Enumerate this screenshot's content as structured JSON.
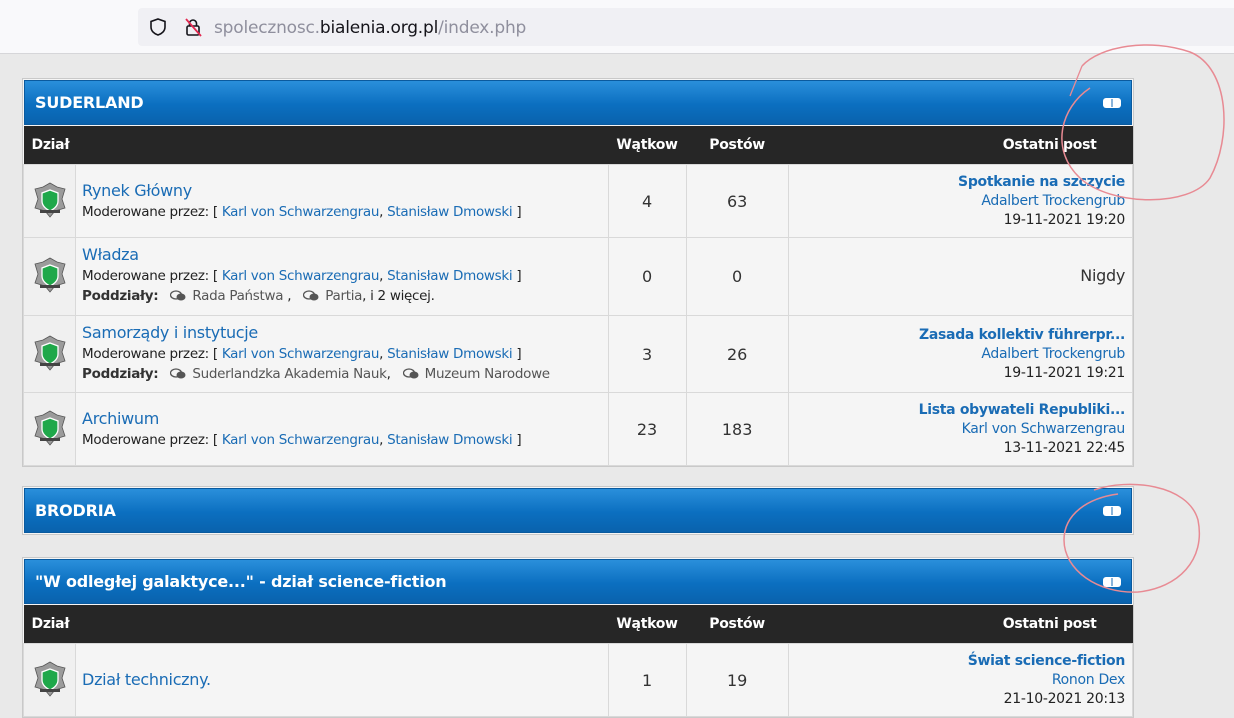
{
  "browser": {
    "url_prefix": "spolecznosc.",
    "url_domain": "bialenia.org.pl",
    "url_path": "/index.php"
  },
  "columns": {
    "forum": "Dział",
    "topics": "Wątkow",
    "posts": "Postów",
    "last_post": "Ostatni post"
  },
  "moderated_label": "Moderowane przez:",
  "subforums_label": "Poddziały:",
  "categories": [
    {
      "title": "SUDERLAND",
      "forums": [
        {
          "name": "Rynek Główny",
          "moderators": [
            "Karl von Schwarzengrau",
            "Stanisław Dmowski"
          ],
          "topics": "4",
          "posts": "63",
          "last_title": "Spotkanie na szczycie",
          "last_author": "Adalbert Trockengrub",
          "last_date": "19-11-2021 19:20"
        },
        {
          "name": "Władza",
          "moderators": [
            "Karl von Schwarzengrau",
            "Stanisław Dmowski"
          ],
          "subforums": [
            "Rada Państwa",
            "Partia"
          ],
          "subforums_more": ", i 2 więcej.",
          "topics": "0",
          "posts": "0",
          "never": "Nigdy"
        },
        {
          "name": "Samorządy i instytucje",
          "moderators": [
            "Karl von Schwarzengrau",
            "Stanisław Dmowski"
          ],
          "subforums": [
            "Suderlandzka Akademia Nauk",
            "Muzeum Narodowe"
          ],
          "topics": "3",
          "posts": "26",
          "last_title": "Zasada kollektiv führerpr...",
          "last_author": "Adalbert Trockengrub",
          "last_date": "19-11-2021 19:21"
        },
        {
          "name": "Archiwum",
          "moderators": [
            "Karl von Schwarzengrau",
            "Stanisław Dmowski"
          ],
          "topics": "23",
          "posts": "183",
          "last_title": "Lista obywateli Republiki...",
          "last_author": "Karl von Schwarzengrau",
          "last_date": "13-11-2021 22:45"
        }
      ]
    },
    {
      "title": "BRODRIA",
      "forums": []
    },
    {
      "title": "\"W odległej galaktyce...\" - dział science-fiction",
      "forums": [
        {
          "name": "Dział techniczny.",
          "topics": "1",
          "posts": "19",
          "last_title": "Świat science-fiction",
          "last_author": "Ronon Dex",
          "last_date": "21-10-2021 20:13"
        }
      ]
    }
  ],
  "colors": {
    "header_blue": "#0b6fc0",
    "table_header": "#262626",
    "link": "#1a6cb5",
    "annotation": "#e88a93"
  },
  "icons": [
    "shield-icon",
    "lock-slash-icon",
    "forum-emblem-icon",
    "chat-bubbles-icon",
    "collapse-icon"
  ]
}
